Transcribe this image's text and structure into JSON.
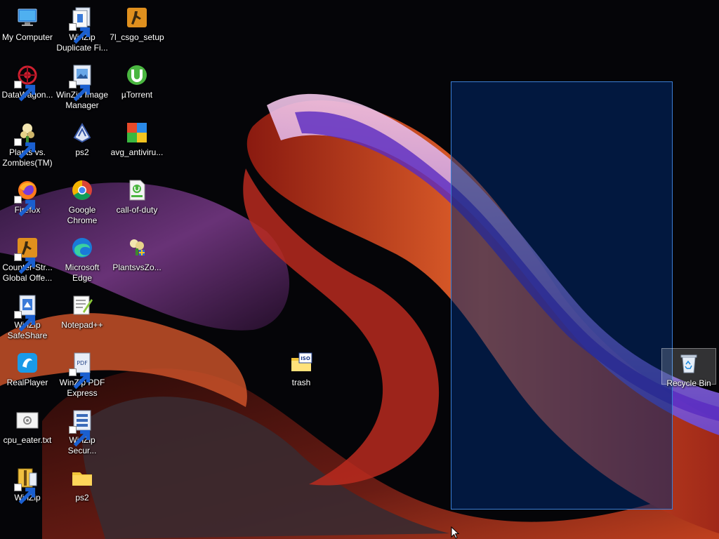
{
  "desktop": {
    "icons": [
      {
        "id": "my-computer",
        "label": "My Computer",
        "icon": "computer-icon"
      },
      {
        "id": "winzip-duplicate",
        "label": "WinZip\nDuplicate Fi...",
        "icon": "winzip-icon"
      },
      {
        "id": "csgo-setup",
        "label": "7l_csgo_setup",
        "icon": "csgo-icon"
      },
      {
        "id": "datawagon",
        "label": "DataWagon...",
        "icon": "datawagon-icon"
      },
      {
        "id": "winzip-image",
        "label": "WinZip Image\nManager",
        "icon": "winzip-icon"
      },
      {
        "id": "utorrent",
        "label": "µTorrent",
        "icon": "utorrent-icon"
      },
      {
        "id": "pvz",
        "label": "Plants vs.\nZombies(TM)",
        "icon": "plants-icon"
      },
      {
        "id": "ps2-app",
        "label": "ps2",
        "icon": "ps2-icon"
      },
      {
        "id": "avg",
        "label": "avg_antiviru...",
        "icon": "avg-icon"
      },
      {
        "id": "firefox",
        "label": "Firefox",
        "icon": "firefox-icon"
      },
      {
        "id": "chrome",
        "label": "Google\nChrome",
        "icon": "chrome-icon"
      },
      {
        "id": "cod",
        "label": "call-of-duty",
        "icon": "torrent-file-icon"
      },
      {
        "id": "counter-strike",
        "label": "Counter-Str...\nGlobal Offe...",
        "icon": "csgo-icon"
      },
      {
        "id": "edge",
        "label": "Microsoft\nEdge",
        "icon": "edge-icon"
      },
      {
        "id": "plantsvszo",
        "label": "PlantsvsZo...",
        "icon": "plants-icon"
      },
      {
        "id": "winzip-safeshare",
        "label": "WinZip\nSafeShare",
        "icon": "winzip-icon"
      },
      {
        "id": "notepadpp",
        "label": "Notepad++",
        "icon": "notepadpp-icon"
      },
      {
        "id": "realplayer",
        "label": "RealPlayer",
        "icon": "realplayer-icon"
      },
      {
        "id": "winzip-pdf",
        "label": "WinZip PDF\nExpress",
        "icon": "winzip-icon"
      },
      {
        "id": "cpu-eater",
        "label": "cpu_eater.txt",
        "icon": "text-file-icon"
      },
      {
        "id": "winzip-secure",
        "label": "WinZip\nSecur...",
        "icon": "winzip-icon"
      },
      {
        "id": "winzip",
        "label": "WinZip",
        "icon": "winzip-icon"
      },
      {
        "id": "ps2-folder",
        "label": "ps2",
        "icon": "folder-icon"
      },
      {
        "id": "trash",
        "label": "trash",
        "icon": "iso-folder-icon"
      },
      {
        "id": "recycle-bin",
        "label": "Recycle Bin",
        "icon": "recycle-bin-icon"
      }
    ]
  },
  "selection": {
    "visible": true
  },
  "colors": {
    "selection_fill": "#00286e",
    "selection_border": "#3b7fd6",
    "desktop_bg": "#050508"
  }
}
